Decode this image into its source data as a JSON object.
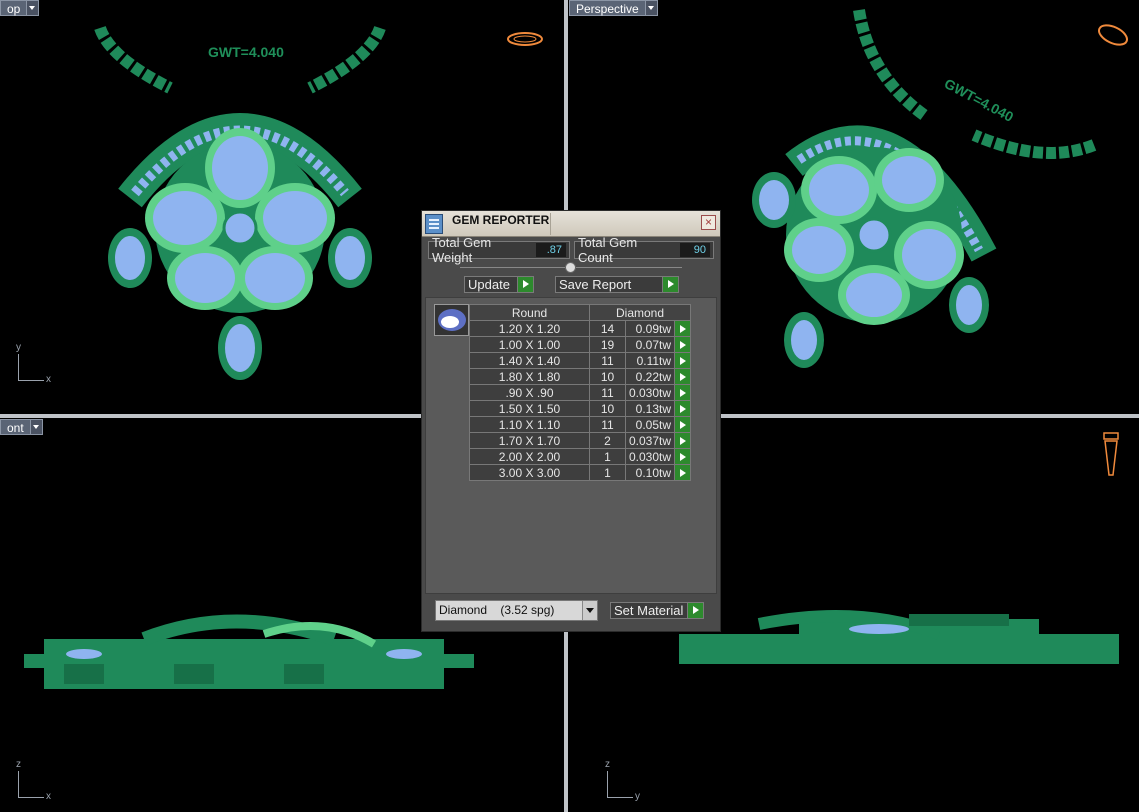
{
  "viewports": {
    "top": {
      "label": "op",
      "gwt": "GWT=4.040",
      "axis_v": "y",
      "axis_h": "x"
    },
    "perspective": {
      "label": "Perspective",
      "gwt": "GWT=4.040"
    },
    "front": {
      "label": "ont",
      "axis_v": "z",
      "axis_h": "x"
    },
    "right": {
      "axis_v": "z",
      "axis_h": "y"
    }
  },
  "dialog": {
    "title": "GEM REPORTER",
    "total_gem_weight_label": "Total Gem Weight",
    "total_gem_weight_value": ".87",
    "total_gem_count_label": "Total Gem Count",
    "total_gem_count_value": "90",
    "update_label": "Update",
    "save_report_label": "Save Report",
    "table": {
      "col_shape": "Round",
      "col_material": "Diamond",
      "rows": [
        {
          "size": "1.20 X 1.20",
          "count": "14",
          "weight": "0.09tw"
        },
        {
          "size": "1.00 X 1.00",
          "count": "19",
          "weight": "0.07tw"
        },
        {
          "size": "1.40 X 1.40",
          "count": "11",
          "weight": "0.11tw"
        },
        {
          "size": "1.80 X 1.80",
          "count": "10",
          "weight": "0.22tw"
        },
        {
          "size": ".90 X .90",
          "count": "11",
          "weight": "0.030tw"
        },
        {
          "size": "1.50 X 1.50",
          "count": "10",
          "weight": "0.13tw"
        },
        {
          "size": "1.10 X 1.10",
          "count": "11",
          "weight": "0.05tw"
        },
        {
          "size": "1.70 X 1.70",
          "count": "2",
          "weight": "0.037tw"
        },
        {
          "size": "2.00 X 2.00",
          "count": "1",
          "weight": "0.030tw"
        },
        {
          "size": "3.00 X 3.00",
          "count": "1",
          "weight": "0.10tw"
        }
      ]
    },
    "material_select": "Diamond    (3.52 spg)",
    "set_material_label": "Set Material"
  },
  "colors": {
    "metal": "#1f8a5a",
    "metal_light": "#5fd08a",
    "gem": "#8fb4f0",
    "accent_green": "#2d8a2d"
  },
  "icons": [
    "ring-nav-icon",
    "pendant-nav-icon",
    "gem-thumbnail-icon",
    "close-icon"
  ]
}
